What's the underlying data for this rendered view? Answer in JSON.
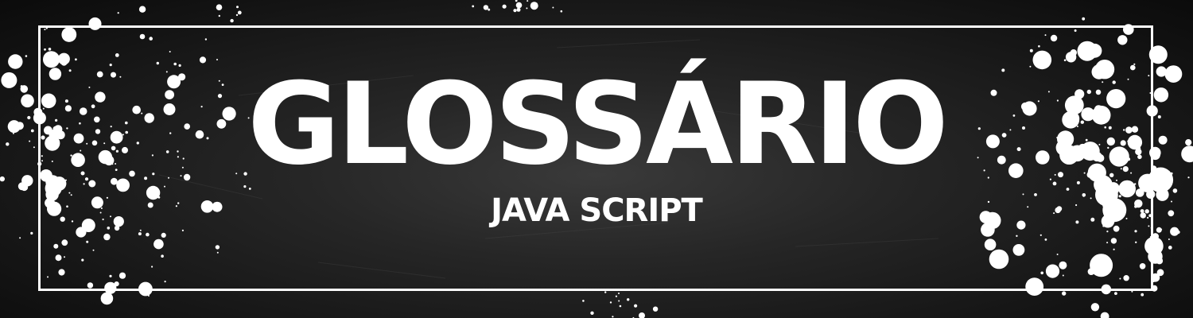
{
  "banner": {
    "title": "GLOSSÁRIO",
    "subtitle": "JAVA SCRIPT"
  },
  "colors": {
    "background": "#1c1c1c",
    "text": "#ffffff",
    "frame": "#ffffff",
    "splatter": "#ffffff"
  }
}
